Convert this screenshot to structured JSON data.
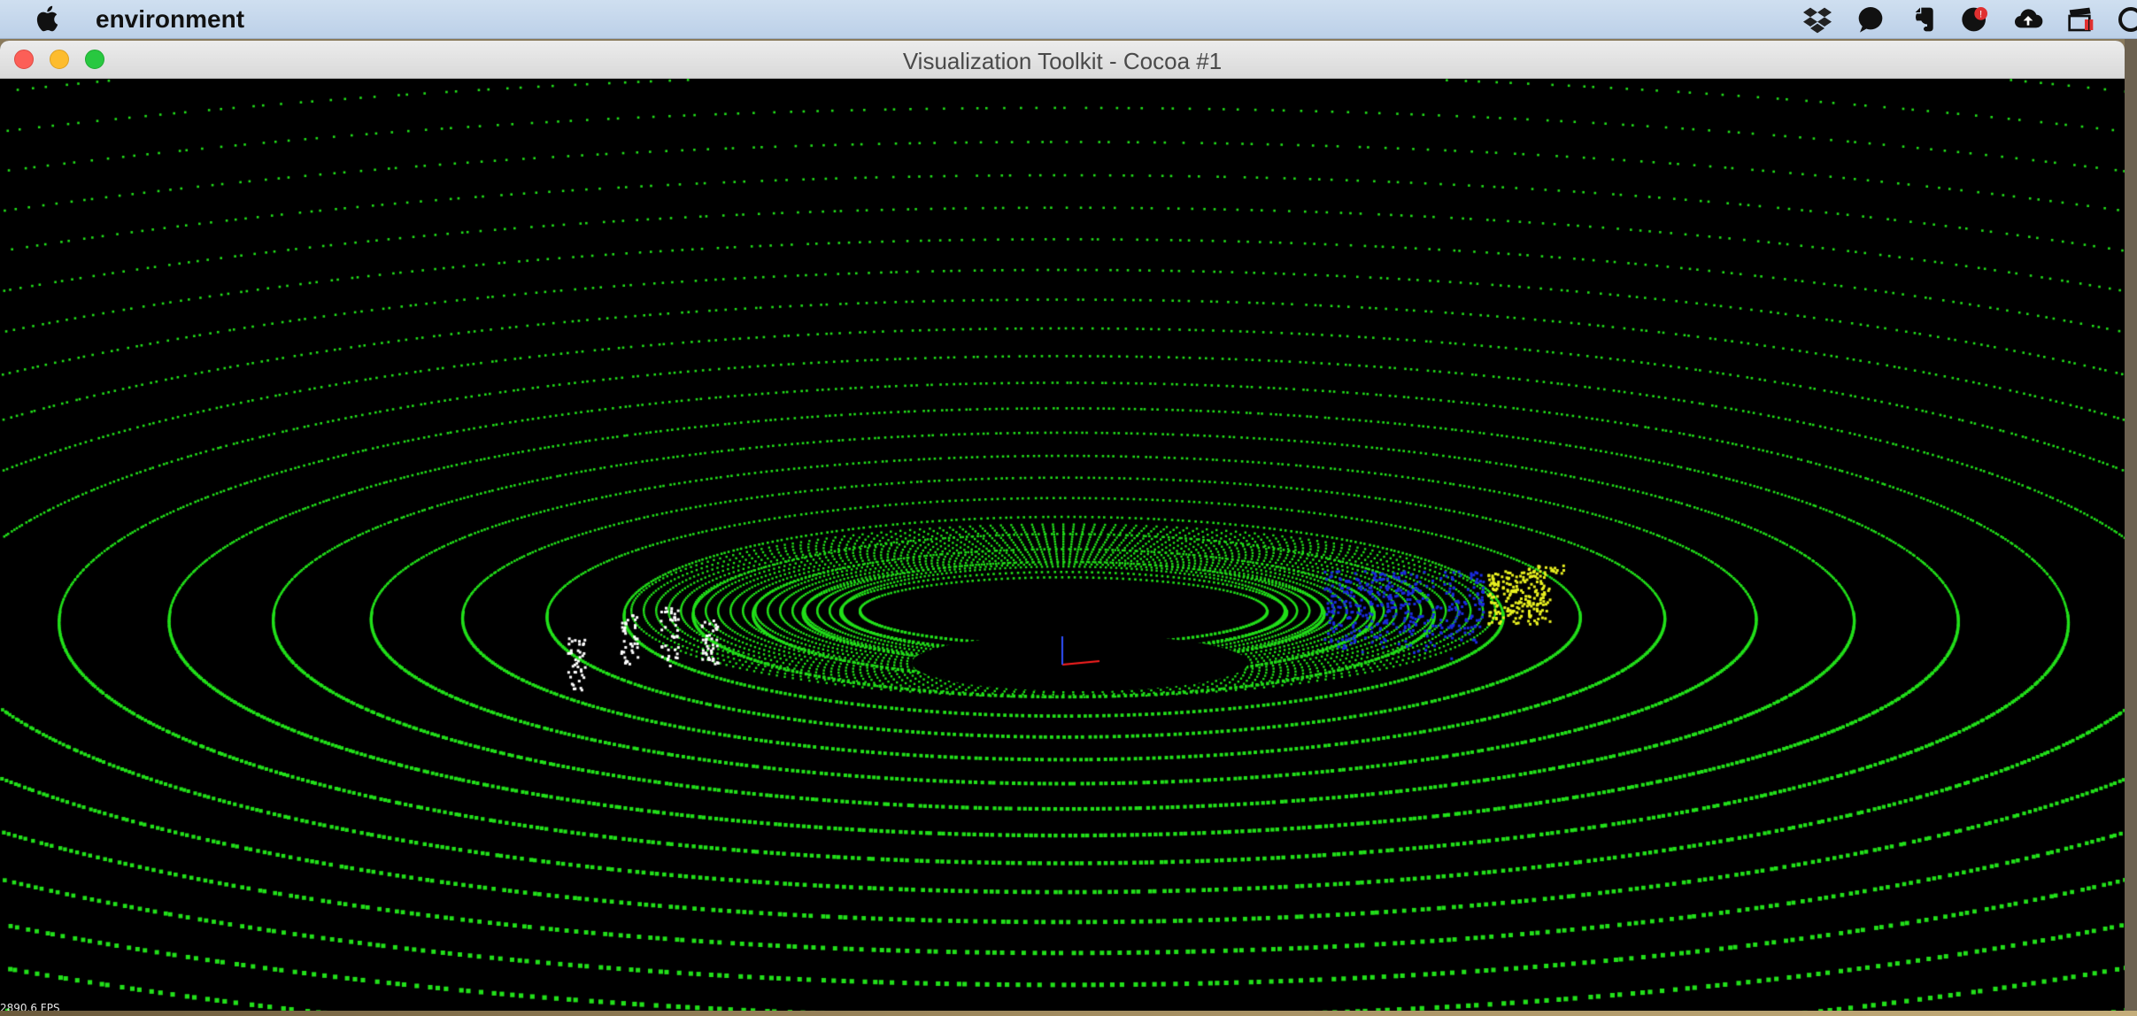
{
  "menubar": {
    "app_name": "environment",
    "tray_icons": [
      "dropbox-icon",
      "chat-bubble-icon",
      "evernote-icon",
      "lastpass-icon",
      "cloud-upload-icon",
      "clapper-icon",
      "help-icon"
    ]
  },
  "window": {
    "title": "Visualization Toolkit - Cocoa #1",
    "fps_label": "2890.6 FPS"
  },
  "scene": {
    "background": "#000000",
    "ground_points_color": "#22e01a",
    "cluster_colors": {
      "white_cluster": "#ffffff",
      "blue_cluster": "#1a2be0",
      "yellow_cluster": "#e8f020"
    },
    "axes_colors": [
      "#ff2020",
      "#3050ff"
    ]
  }
}
